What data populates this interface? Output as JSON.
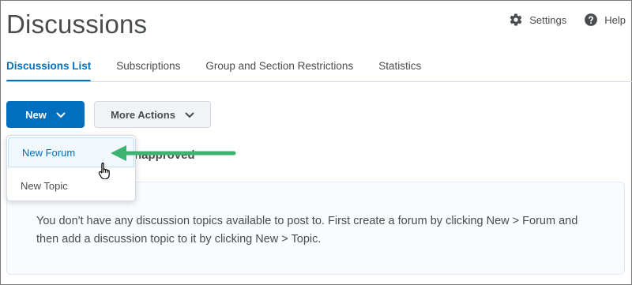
{
  "page": {
    "title": "Discussions"
  },
  "header": {
    "settings_label": "Settings",
    "help_label": "Help",
    "settings_icon": "gear-icon",
    "help_icon": "question-circle-icon"
  },
  "tabs": [
    {
      "label": "Discussions List",
      "active": true
    },
    {
      "label": "Subscriptions",
      "active": false
    },
    {
      "label": "Group and Section Restrictions",
      "active": false
    },
    {
      "label": "Statistics",
      "active": false
    }
  ],
  "toolbar": {
    "new_label": "New",
    "more_actions_label": "More Actions"
  },
  "dropdown": {
    "items": [
      {
        "label": "New Forum",
        "highlighted": true
      },
      {
        "label": "New Topic",
        "highlighted": false
      }
    ]
  },
  "obscured_text": "napproved",
  "empty_message": "You don't have any discussion topics available to post to. First create a forum by clicking New > Forum and then add a discussion topic to it by clicking New > Topic.",
  "colors": {
    "primary": "#006fbf",
    "text": "#494c4e",
    "annotation_arrow": "#3cb371"
  }
}
